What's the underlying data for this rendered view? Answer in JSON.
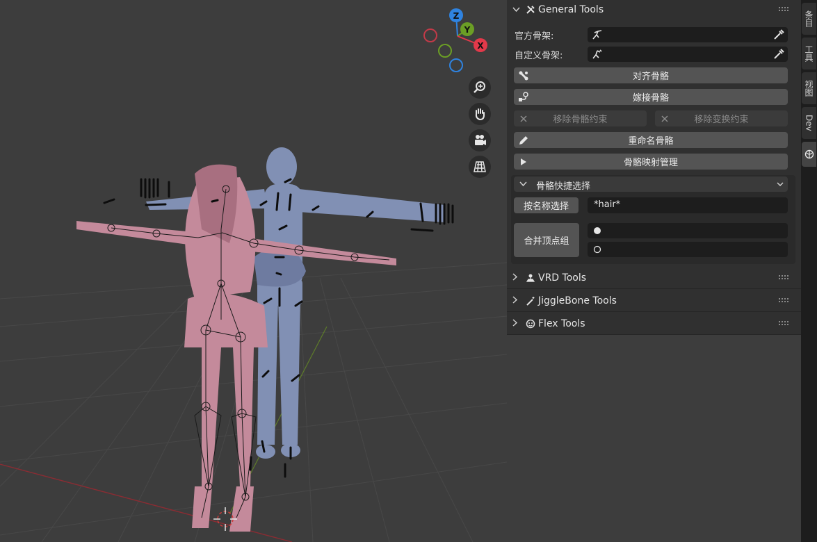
{
  "gizmo": {
    "z_label": "Z",
    "y_label": "Y",
    "x_label": "X",
    "colors": {
      "x": "#e2394a",
      "y": "#6b9e25",
      "z": "#2f83e0"
    }
  },
  "nav_buttons": [
    "zoom-icon",
    "hand-icon",
    "camera-icon",
    "grid-icon"
  ],
  "general_tools": {
    "title": "General Tools",
    "official_rig_label": "官方骨架:",
    "custom_rig_label": "自定义骨架:",
    "align_bones": "对齐骨骼",
    "graft_bones": "嫁接骨骼",
    "remove_bone_constraints": "移除骨骼约束",
    "remove_transform_constraints": "移除变换约束",
    "rename_bones": "重命名骨骼",
    "bone_mapping": "骨骼映射管理",
    "quick_select": {
      "title": "骨骼快捷选择",
      "select_by_name": "按名称选择",
      "name_pattern": "*hair*",
      "merge_vertex_groups": "合并顶点组"
    }
  },
  "collapsed_panels": [
    {
      "title": "VRD Tools"
    },
    {
      "title": "JiggleBone Tools"
    },
    {
      "title": "Flex Tools"
    }
  ],
  "tabs": [
    "条目",
    "工具",
    "视图",
    "Dev"
  ]
}
